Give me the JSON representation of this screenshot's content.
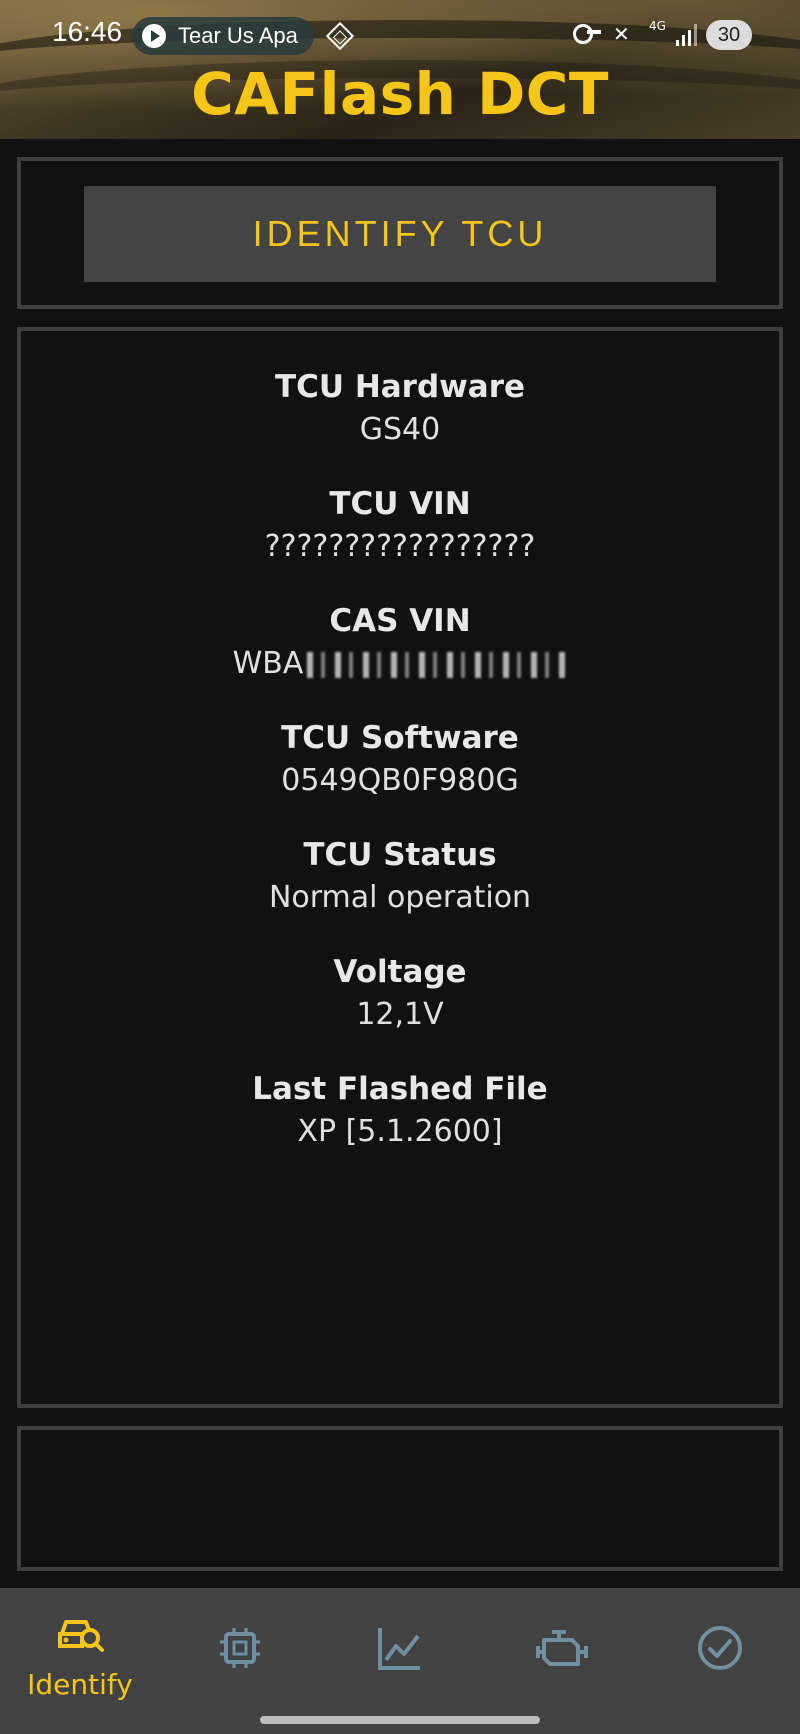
{
  "status_bar": {
    "time": "16:46",
    "media_text": "Tear Us Apa",
    "network": "4G",
    "battery": "30"
  },
  "header": {
    "title": "CAFlash DCT"
  },
  "actions": {
    "identify_label": "IDENTIFY TCU"
  },
  "info": {
    "hardware_label": "TCU Hardware",
    "hardware_value": "GS40",
    "tcu_vin_label": "TCU VIN",
    "tcu_vin_value": "?????????????????",
    "cas_vin_label": "CAS VIN",
    "cas_vin_prefix": "WBA",
    "software_label": "TCU Software",
    "software_value": "0549QB0F980G",
    "status_label": "TCU Status",
    "status_value": "Normal operation",
    "voltage_label": "Voltage",
    "voltage_value": "12,1V",
    "last_file_label": "Last Flashed File",
    "last_file_value": "XP [5.1.2600]"
  },
  "nav": {
    "items": [
      {
        "label": "Identify",
        "icon": "car-search-icon",
        "active": true
      },
      {
        "label": "",
        "icon": "chip-icon",
        "active": false
      },
      {
        "label": "",
        "icon": "chart-icon",
        "active": false
      },
      {
        "label": "",
        "icon": "engine-icon",
        "active": false
      },
      {
        "label": "",
        "icon": "check-circle-icon",
        "active": false
      }
    ]
  },
  "colors": {
    "accent": "#f5c518",
    "inactive_icon": "#6f8fa3",
    "background": "#111111",
    "panel_border": "#3f3f3f",
    "nav_background": "#424242"
  }
}
